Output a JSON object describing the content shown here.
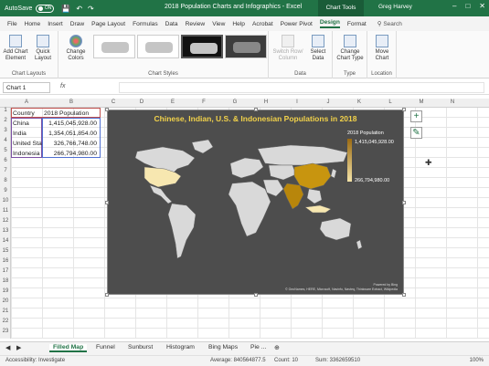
{
  "titlebar": {
    "autosave_label": "AutoSave",
    "autosave_state": "ON",
    "doc_title": "2018 Population Charts and Infographics - Excel",
    "tools_label": "Chart Tools",
    "user": "Greg Harvey"
  },
  "tabs": [
    "File",
    "Home",
    "Insert",
    "Draw",
    "Page Layout",
    "Formulas",
    "Data",
    "Review",
    "View",
    "Help",
    "Acrobat",
    "Power Pivot",
    "Design",
    "Format"
  ],
  "search_label": "Search",
  "ribbon": {
    "add_chart_element": "Add Chart Element",
    "quick_layout": "Quick Layout",
    "change_colors": "Change Colors",
    "switch_row_column": "Switch Row/ Column",
    "select_data": "Select Data",
    "change_chart_type": "Change Chart Type",
    "move_chart": "Move Chart",
    "groups": {
      "chart_layouts": "Chart Layouts",
      "chart_styles": "Chart Styles",
      "data": "Data",
      "type": "Type",
      "location": "Location"
    }
  },
  "namebox": "Chart 1",
  "fx_label": "fx",
  "columns": [
    "A",
    "B",
    "C",
    "D",
    "E",
    "F",
    "G",
    "H",
    "I",
    "J",
    "K",
    "L",
    "M",
    "N"
  ],
  "rows": [
    "1",
    "2",
    "3",
    "4",
    "5",
    "6",
    "7",
    "8",
    "9",
    "10",
    "11",
    "12",
    "13",
    "14",
    "15",
    "16",
    "17",
    "18",
    "19",
    "20",
    "21",
    "22",
    "23"
  ],
  "table": {
    "header": [
      "Country",
      "2018 Population"
    ],
    "rows": [
      [
        "China",
        "1,415,045,928.00"
      ],
      [
        "India",
        "1,354,051,854.00"
      ],
      [
        "United States",
        "326,766,748.00"
      ],
      [
        "Indonesia",
        "266,794,980.00"
      ]
    ]
  },
  "chart": {
    "title": "Chinese, Indian, U.S. & Indonesian Populations in 2018",
    "legend_title": "2018 Population",
    "legend_max": "1,415,045,928.00",
    "legend_min": "266,794,980.00",
    "credit_line1": "Powered by Bing",
    "credit_line2": "© GeoNames, HERE, Microsoft, Navinfo, Navteq, Thinkware Extract, Wikipedia",
    "colors": {
      "background": "#4d4d4d",
      "land": "#d9d9d9",
      "title": "#f2d24a",
      "high": "#b8860b",
      "low": "#f7e7b0"
    }
  },
  "chart_data": {
    "type": "map",
    "title": "Chinese, Indian, U.S. & Indonesian Populations in 2018",
    "legend_title": "2018 Population",
    "regions": [
      {
        "name": "China",
        "value": 1415045928
      },
      {
        "name": "India",
        "value": 1354051854
      },
      {
        "name": "United States",
        "value": 326766748
      },
      {
        "name": "Indonesia",
        "value": 266794980
      }
    ],
    "range": [
      266794980,
      1415045928
    ],
    "legend_position": "top-right"
  },
  "sheet_tabs": [
    "Filled Map",
    "Funnel",
    "Sunburst",
    "Histogram",
    "Bing Maps",
    "Pie ..."
  ],
  "status": {
    "left": "Accessibility: Investigate",
    "average": "Average: 840564877.5",
    "count": "Count: 10",
    "sum": "Sum: 3362659510",
    "zoom": "100%"
  }
}
